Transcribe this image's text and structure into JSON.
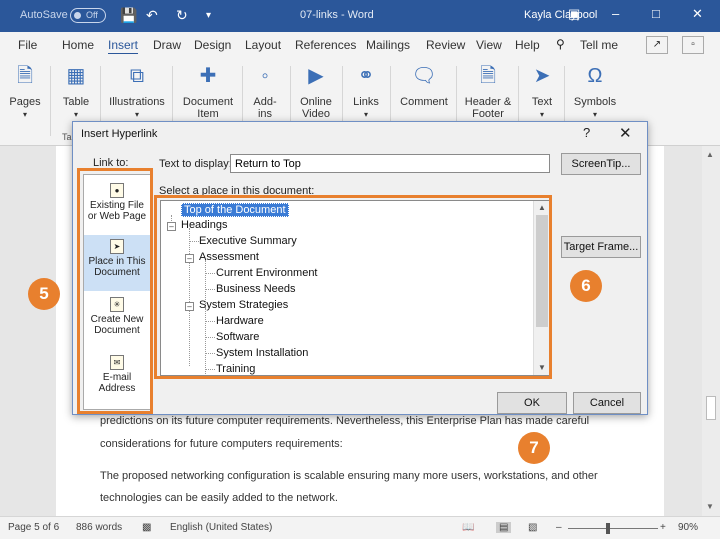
{
  "titlebar": {
    "autosave": "AutoSave",
    "toggle": "Off",
    "doc_title": "07-links - Word",
    "user": "Kayla Claypool"
  },
  "tabs": [
    "File",
    "Home",
    "Insert",
    "Draw",
    "Design",
    "Layout",
    "References",
    "Mailings",
    "Review",
    "View",
    "Help"
  ],
  "tell_me": "Tell me",
  "ribbon": {
    "pages": "Pages",
    "table": "Table",
    "table_group": "Ta",
    "illustrations": "Illustrations",
    "document_item": [
      "Document",
      "Item"
    ],
    "addins": "Add-ins",
    "online_video": [
      "Online",
      "Video"
    ],
    "links": "Links",
    "comment": "Comment",
    "header_footer": [
      "Header &",
      "Footer"
    ],
    "text": "Text",
    "symbols": "Symbols"
  },
  "document": {
    "line1": "predictions on its future computer requirements. Nevertheless, this Enterprise Plan has made careful",
    "line2": "considerations for future computers requirements:",
    "line3": "The proposed networking configuration is scalable ensuring many more users, workstations, and other",
    "line4": "technologies can be easily added to the network."
  },
  "statusbar": {
    "page": "Page 5 of 6",
    "words": "886 words",
    "language": "English (United States)",
    "zoom": "90%"
  },
  "dialog": {
    "title": "Insert Hyperlink",
    "help": "?",
    "link_to": "Link to:",
    "text_to_display_label": "Text to display:",
    "text_to_display_value": "Return to Top",
    "screentip": "ScreenTip...",
    "select_place": "Select a place in this document:",
    "target_frame": "Target Frame...",
    "ok": "OK",
    "cancel": "Cancel",
    "nav": [
      [
        "Existing File",
        "or Web Page"
      ],
      [
        "Place in This",
        "Document"
      ],
      [
        "Create New",
        "Document"
      ],
      [
        "E-mail",
        "Address"
      ]
    ],
    "tree": {
      "top": "Top of the Document",
      "headings": "Headings",
      "executive_summary": "Executive Summary",
      "assessment": "Assessment",
      "current_environment": "Current Environment",
      "business_needs": "Business Needs",
      "system_strategies": "System Strategies",
      "hardware": "Hardware",
      "software": "Software",
      "system_installation": "System Installation",
      "training": "Training"
    }
  },
  "callouts": {
    "nav": "5",
    "tree": "6",
    "ok": "7"
  },
  "colors": {
    "title_bar": "#2b579a",
    "callout": "#e8802e",
    "selection": "#3a7bd5"
  }
}
